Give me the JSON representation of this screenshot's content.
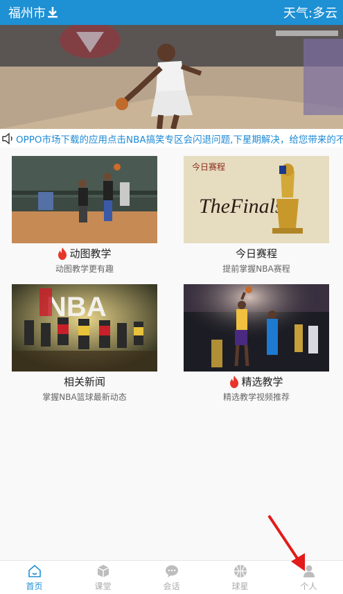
{
  "header": {
    "city": "福州市",
    "weather": "天气:多云"
  },
  "notice": {
    "text": "OPPO市场下载的应用点击NBA搞笑专区会闪退问题,下星期解决，给您带来的不便"
  },
  "cards": [
    {
      "title": "动图教学",
      "subtitle": "动图教学更有趣",
      "hot": true
    },
    {
      "title": "今日赛程",
      "subtitle": "提前掌握NBA赛程",
      "hot": false,
      "image_text_top": "今日赛程",
      "image_text_logo": "TheFinals"
    },
    {
      "title": "相关新闻",
      "subtitle": "掌握NBA篮球最新动态",
      "hot": false,
      "image_text_logo": "NBA"
    },
    {
      "title": "精选教学",
      "subtitle": "精选教学视频推荐",
      "hot": true
    }
  ],
  "tabs": [
    {
      "label": "首页",
      "icon": "home-icon",
      "active": true
    },
    {
      "label": "课堂",
      "icon": "cube-icon",
      "active": false
    },
    {
      "label": "会话",
      "icon": "chat-icon",
      "active": false
    },
    {
      "label": "球星",
      "icon": "basketball-icon",
      "active": false
    },
    {
      "label": "个人",
      "icon": "person-icon",
      "active": false
    }
  ],
  "colors": {
    "accent": "#1e90d4",
    "fire": "#e8352a",
    "arrow": "#e21b1b"
  }
}
